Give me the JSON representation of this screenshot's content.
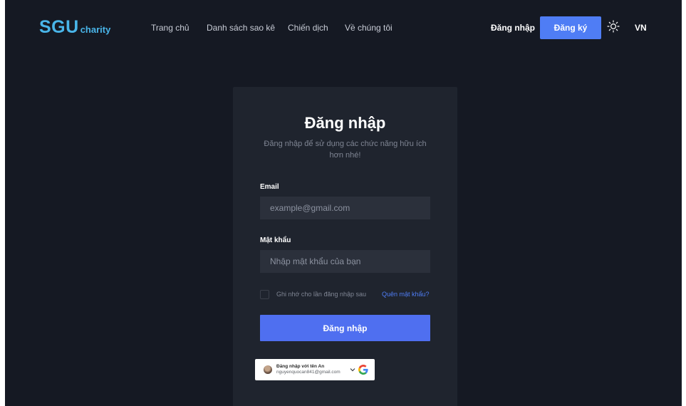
{
  "header": {
    "logo_main": "SGU",
    "logo_sub": "charity",
    "nav": [
      "Trang chủ",
      "Danh sách sao kê",
      "Chiến dịch",
      "Về chúng tôi"
    ],
    "login_label": "Đăng nhập",
    "register_label": "Đăng ký",
    "theme_icon": "sun-icon",
    "language": "VN"
  },
  "login_card": {
    "title": "Đăng nhập",
    "subtitle": "Đăng nhập để sử dụng các chức năng hữu ích hơn nhé!",
    "email_label": "Email",
    "email_placeholder": "example@gmail.com",
    "password_label": "Mật khẩu",
    "password_placeholder": "Nhập mật khẩu của bạn",
    "remember_label": "Ghi nhớ cho lần đăng nhập sau",
    "forgot_label": "Quên mật khẩu?",
    "submit_label": "Đăng nhập"
  },
  "google_signin": {
    "title": "Đăng nhập với tên An",
    "email": "nguyenquocan841@gmail.com"
  },
  "colors": {
    "background": "#151923",
    "card": "#1f242e",
    "accent": "#4f7df5",
    "logo": "#49b5e9"
  }
}
